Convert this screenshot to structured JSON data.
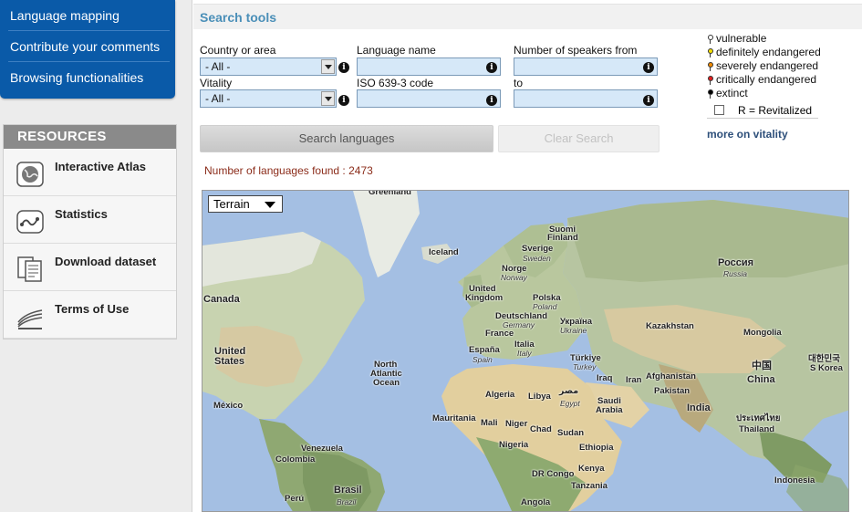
{
  "nav": {
    "items": [
      "Language mapping",
      "Contribute your comments",
      "Browsing functionalities"
    ]
  },
  "resources": {
    "title": "RESOURCES",
    "items": [
      {
        "label": "Interactive Atlas",
        "icon": "globe-icon"
      },
      {
        "label": "Statistics",
        "icon": "statistics-icon"
      },
      {
        "label": "Download dataset",
        "icon": "document-icon"
      },
      {
        "label": "Terms of Use",
        "icon": "book-icon"
      }
    ]
  },
  "search": {
    "title": "Search tools",
    "country_label": "Country or area",
    "country_value": "- All -",
    "language_label": "Language name",
    "speakers_from_label": "Number of speakers from",
    "vitality_label": "Vitality",
    "vitality_value": "- All -",
    "iso_label": "ISO 639-3 code",
    "to_label": "to",
    "search_button": "Search languages",
    "clear_button": "Clear Search",
    "found_text": "Number of languages found : 2473"
  },
  "legend": {
    "items": [
      {
        "label": "vulnerable",
        "color": "#ffffff"
      },
      {
        "label": "definitely endangered",
        "color": "#f5e000"
      },
      {
        "label": "severely endangered",
        "color": "#f08a00"
      },
      {
        "label": "critically endangered",
        "color": "#e02020"
      },
      {
        "label": "extinct",
        "color": "#000000"
      }
    ],
    "revitalized_label": "R = Revitalized",
    "more_link": "more on vitality"
  },
  "map": {
    "type_selector": "Terrain",
    "labels": {
      "greenland": "Greenland",
      "iceland": "Iceland",
      "suomi": "Suomi",
      "finland": "Finland",
      "sverige": "Sverige",
      "sweden": "Sweden",
      "norge": "Norge",
      "norway": "Norway",
      "uk": "United",
      "kingdom": "Kingdom",
      "polska": "Polska",
      "poland": "Poland",
      "deutschland": "Deutschland",
      "germany": "Germany",
      "ukraina": "Україна",
      "ukraine": "Ukraine",
      "france": "France",
      "espana": "España",
      "spain": "Spain",
      "italia": "Italia",
      "italy": "Italy",
      "turkiye": "Türkiye",
      "turkey": "Turkey",
      "rossiya": "Россия",
      "russia": "Russia",
      "kazakhstan": "Kazakhstan",
      "mongolia": "Mongolia",
      "zhongguo": "中国",
      "china": "China",
      "korea_native": "대한민국",
      "korea": "S Korea",
      "afghanistan": "Afghanistan",
      "pakistan": "Pakistan",
      "iraq": "Iraq",
      "iran": "Iran",
      "india": "India",
      "thailand_native": "ประเทศไทย",
      "thailand": "Thailand",
      "indonesia": "Indonesia",
      "canada": "Canada",
      "us1": "United",
      "us2": "States",
      "mexico": "México",
      "colombia": "Colombia",
      "venezuela": "Venezuela",
      "brasil": "Brasil",
      "brazil": "Brazil",
      "peru": "Perú",
      "north_atlantic1": "North",
      "north_atlantic2": "Atlantic",
      "north_atlantic3": "Ocean",
      "algeria": "Algeria",
      "libya": "Libya",
      "misr": "مصر",
      "egypt": "Egypt",
      "saudi1": "Saudi",
      "saudi2": "Arabia",
      "mauritania": "Mauritania",
      "mali": "Mali",
      "niger": "Niger",
      "chad": "Chad",
      "sudan": "Sudan",
      "nigeria": "Nigeria",
      "ethiopia": "Ethiopia",
      "drc": "DR Congo",
      "kenya": "Kenya",
      "tanzania": "Tanzania",
      "angola": "Angola"
    }
  },
  "colors": {
    "nav_bg": "#0a5aa8",
    "title": "#4a8fb8",
    "ocean": "#a4bfe3",
    "found": "#8b2c1a"
  }
}
